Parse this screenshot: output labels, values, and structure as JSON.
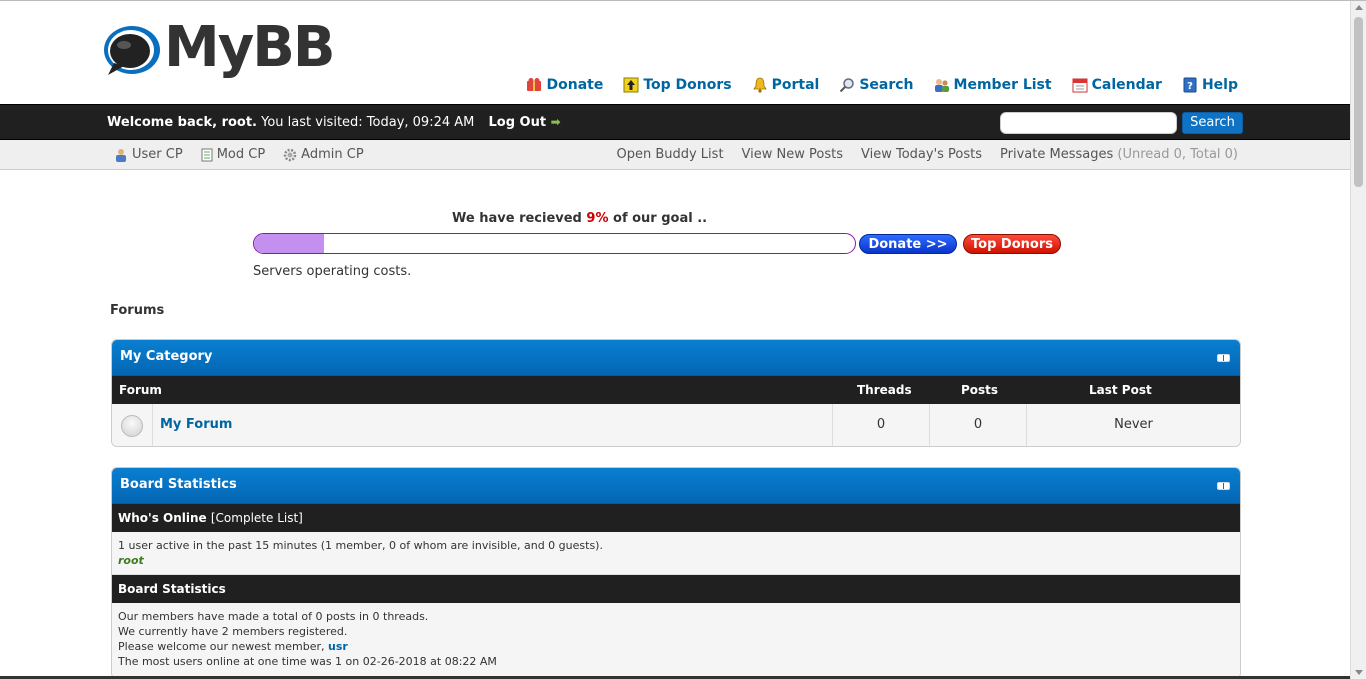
{
  "header": {
    "logo_text": "MyBB",
    "links": [
      {
        "label": "Donate",
        "icon": "donate-icon"
      },
      {
        "label": "Top Donors",
        "icon": "top-donors-icon"
      },
      {
        "label": "Portal",
        "icon": "portal-icon"
      },
      {
        "label": "Search",
        "icon": "search-icon"
      },
      {
        "label": "Member List",
        "icon": "member-list-icon"
      },
      {
        "label": "Calendar",
        "icon": "calendar-icon"
      },
      {
        "label": "Help",
        "icon": "help-icon"
      }
    ]
  },
  "welcome": {
    "greeting": "Welcome back, root.",
    "last_visit": " You last visited: Today, 09:24 AM",
    "logout": "Log Out",
    "search_button": "Search",
    "search_value": ""
  },
  "panel": {
    "user_cp": "User CP",
    "mod_cp": "Mod CP",
    "admin_cp": "Admin CP",
    "buddy_list": "Open Buddy List",
    "new_posts": "View New Posts",
    "todays_posts": "View Today's Posts",
    "private_messages": "Private Messages",
    "pm_counts": "(Unread 0, Total 0)"
  },
  "donation": {
    "goal_prefix": "We have recieved ",
    "percent": "9%",
    "goal_suffix": " of our goal ..",
    "progress_fraction": 0.09,
    "donate_button": "Donate  >>",
    "top_donors_button": "Top Donors",
    "description": "Servers operating costs."
  },
  "forums": {
    "section_label": "Forums",
    "category_title": "My Category",
    "columns": {
      "forum": "Forum",
      "threads": "Threads",
      "posts": "Posts",
      "last_post": "Last Post"
    },
    "rows": [
      {
        "name": "My Forum",
        "threads": "0",
        "posts": "0",
        "last_post": "Never"
      }
    ]
  },
  "stats": {
    "title": "Board Statistics",
    "whos_online": "Who's Online",
    "complete_list": "[Complete List]",
    "online_summary": "1 user active in the past 15 minutes (1 member, 0 of whom are invisible, and 0 guests).",
    "online_user": "root",
    "stats_header": "Board Statistics",
    "line1": "Our members have made a total of 0 posts in 0 threads.",
    "line2": "We currently have 2 members registered.",
    "line3_prefix": "Please welcome our newest member, ",
    "newest_member": "usr",
    "line4": "The most users online at one time was 1 on 02-26-2018 at 08:22 AM"
  },
  "colors": {
    "header_blue": "#0a7fd1",
    "dark_bar": "#202020",
    "link": "#0066a2",
    "progress_fill": "#c490f0"
  }
}
